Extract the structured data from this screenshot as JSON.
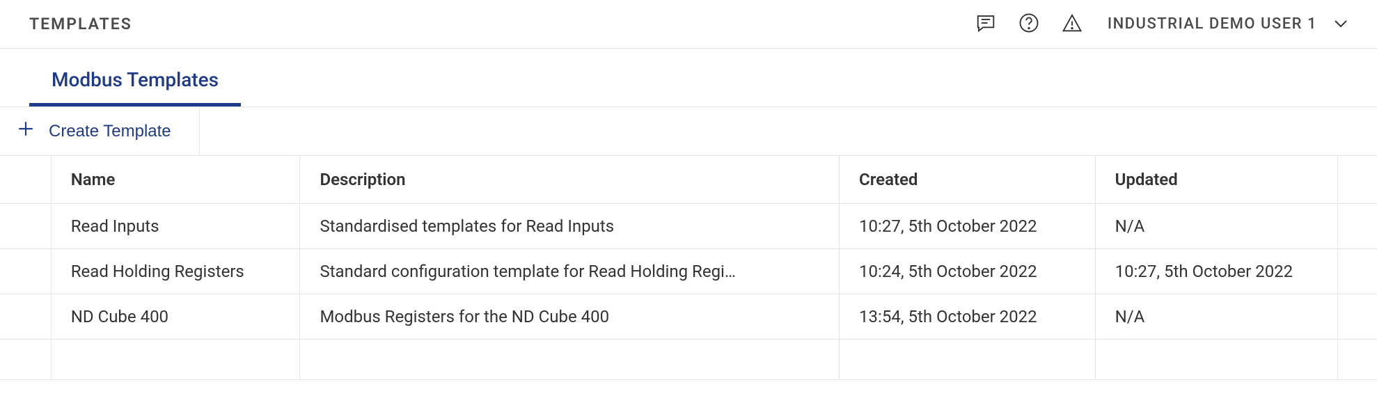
{
  "header": {
    "title": "TEMPLATES",
    "user_name": "INDUSTRIAL DEMO USER 1"
  },
  "tabs": [
    {
      "label": "Modbus Templates",
      "active": true
    }
  ],
  "actions": {
    "create_label": "Create Template"
  },
  "table": {
    "columns": {
      "name": "Name",
      "description": "Description",
      "created": "Created",
      "updated": "Updated"
    },
    "rows": [
      {
        "name": "Read Inputs",
        "description": "Standardised templates for Read Inputs",
        "created": "10:27, 5th October 2022",
        "updated": "N/A"
      },
      {
        "name": "Read Holding Registers",
        "description": "Standard configuration template for Read Holding Regi…",
        "created": "10:24, 5th October 2022",
        "updated": "10:27, 5th October 2022"
      },
      {
        "name": "ND Cube 400",
        "description": "Modbus Registers for the ND Cube 400",
        "created": "13:54, 5th October 2022",
        "updated": "N/A"
      }
    ]
  }
}
